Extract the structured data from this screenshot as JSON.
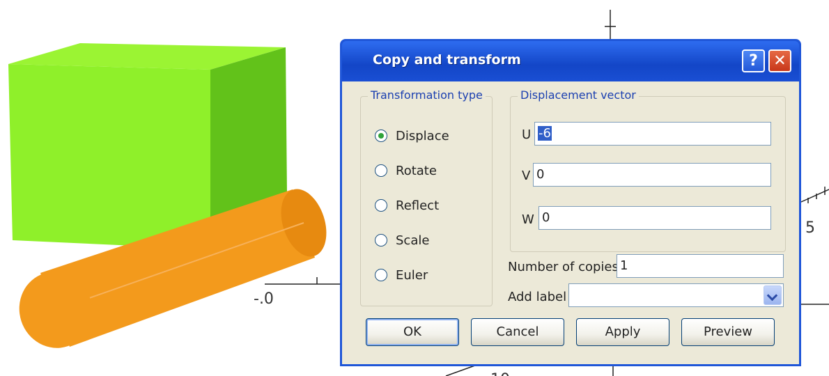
{
  "scene": {
    "axis_labels": [
      {
        "id": "minus-zero",
        "text": "-.0"
      },
      {
        "id": "five",
        "text": "5"
      },
      {
        "id": "ten",
        "text": "10"
      }
    ],
    "colors": {
      "cube": "#8ff02a",
      "cylinder": "#f39a1c"
    }
  },
  "dialog": {
    "title": "Copy and transform",
    "help_icon": "question-mark",
    "close_icon": "x",
    "transformation_type": {
      "title": "Transformation type",
      "options": [
        {
          "label": "Displace",
          "checked": true
        },
        {
          "label": "Rotate",
          "checked": false
        },
        {
          "label": "Reflect",
          "checked": false
        },
        {
          "label": "Scale",
          "checked": false
        },
        {
          "label": "Euler",
          "checked": false
        }
      ]
    },
    "displacement_vector": {
      "title": "Displacement vector",
      "u_label": "U",
      "u_value": "-6",
      "v_label": "V",
      "v_value": "0",
      "w_label": "W",
      "w_value": "0"
    },
    "copies_label": "Number of copies",
    "copies_value": "1",
    "add_label_label": "Add label",
    "add_label_value": "",
    "buttons": {
      "ok": "OK",
      "cancel": "Cancel",
      "apply": "Apply",
      "preview": "Preview"
    },
    "colors": {
      "title_bar": "#1f56d8",
      "client": "#ece9d8",
      "group_title": "#1a3fb0"
    }
  }
}
